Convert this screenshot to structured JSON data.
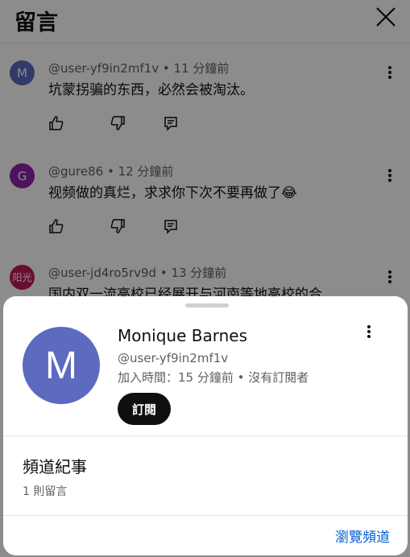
{
  "header": {
    "title": "留言"
  },
  "comments": [
    {
      "avatar_letter": "M",
      "avatar_color": "#5c6bc0",
      "meta": "@user-yf9in2mf1v • 11 分鐘前",
      "text": "坑蒙拐骗的东西，必然会被淘汰。"
    },
    {
      "avatar_letter": "G",
      "avatar_color": "#8e24aa",
      "meta": "@gure86 • 12 分鐘前",
      "text": "视频做的真烂，求求你下次不要再做了😂"
    },
    {
      "avatar_letter": "阳光",
      "avatar_color": "#c2185b",
      "meta": "@user-jd4ro5rv9d • 13 分鐘前",
      "text": "国内双一流高校已经展开与河南等地高校的合"
    }
  ],
  "profile_sheet": {
    "avatar_letter": "M",
    "name": "Monique Barnes",
    "handle": "@user-yf9in2mf1v",
    "joined": "加入時間：15 分鐘前 • 沒有訂閱者",
    "subscribe_label": "訂閱",
    "section_title": "頻道紀事",
    "section_sub": "1 則留言",
    "browse_label": "瀏覽頻道"
  },
  "colors": {
    "accent": "#065fd4",
    "subscribe_bg": "#0f0f0f"
  }
}
